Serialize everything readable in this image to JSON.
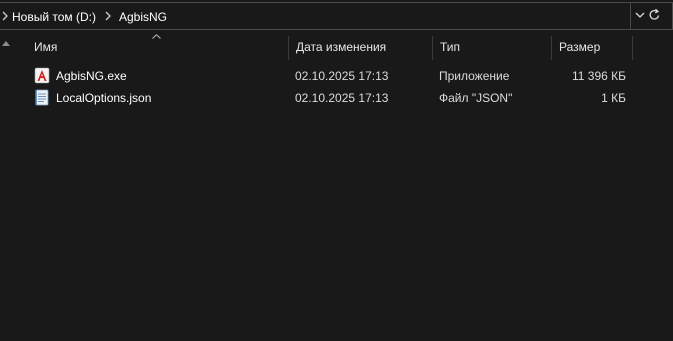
{
  "breadcrumb": {
    "items": [
      "Новый том (D:)",
      "AgbisNG"
    ]
  },
  "columns": {
    "name": "Имя",
    "date": "Дата изменения",
    "type": "Тип",
    "size": "Размер"
  },
  "files": [
    {
      "name": "AgbisNG.exe",
      "date": "02.10.2025 17:13",
      "type": "Приложение",
      "size": "11 396 КБ",
      "icon": "application-icon"
    },
    {
      "name": "LocalOptions.json",
      "date": "02.10.2025 17:13",
      "type": "Файл \"JSON\"",
      "size": "1 КБ",
      "icon": "json-file-icon"
    }
  ],
  "colors": {
    "background": "#191919",
    "border": "#4a4a4a",
    "text": "#ffffff"
  }
}
